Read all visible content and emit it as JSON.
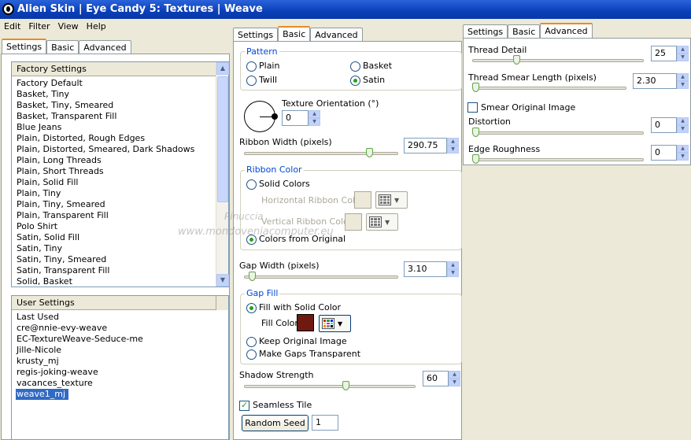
{
  "title": "Alien Skin  |  Eye Candy 5: Textures  |  Weave",
  "menu": [
    "Edit",
    "Filter",
    "View",
    "Help"
  ],
  "panel1": {
    "tabs": [
      "Settings",
      "Basic",
      "Advanced"
    ],
    "factory_header": "Factory Settings",
    "factory_items": [
      "Factory Default",
      "Basket, Tiny",
      "Basket, Tiny, Smeared",
      "Basket, Transparent Fill",
      "Blue Jeans",
      "Plain, Distorted, Rough Edges",
      "Plain, Distorted, Smeared, Dark Shadows",
      "Plain, Long Threads",
      "Plain, Short Threads",
      "Plain, Solid Fill",
      "Plain, Tiny",
      "Plain, Tiny, Smeared",
      "Plain, Transparent Fill",
      "Polo Shirt",
      "Satin, Solid Fill",
      "Satin, Tiny",
      "Satin, Tiny, Smeared",
      "Satin, Transparent Fill",
      "Solid, Basket"
    ],
    "user_header": "User Settings",
    "user_items": [
      "Last Used",
      "cre@nnie-evy-weave",
      "EC-TextureWeave-Seduce-me",
      "Jille-Nicole",
      "krusty_mj",
      "regis-joking-weave",
      "vacances_texture",
      "weave1_mj"
    ]
  },
  "panel2": {
    "tabs": [
      "Settings",
      "Basic",
      "Advanced"
    ],
    "pattern_label": "Pattern",
    "pattern": {
      "plain": "Plain",
      "basket": "Basket",
      "twill": "Twill",
      "satin": "Satin",
      "selected": "Satin"
    },
    "orientation_label": "Texture Orientation (°)",
    "orientation_value": "0",
    "ribbon_width_label": "Ribbon Width (pixels)",
    "ribbon_width_value": "290.75",
    "ribbon_width_level": 0.83,
    "ribbon_color_label": "Ribbon Color",
    "solid_colors": "Solid Colors",
    "horizontal_color": "Horizontal Ribbon Color",
    "vertical_color": "Vertical Ribbon Color",
    "from_original": "Colors from Original",
    "gap_width_label": "Gap Width (pixels)",
    "gap_width_value": "3.10",
    "gap_width_level": 0.03,
    "gap_fill_label": "Gap Fill",
    "fill_solid": "Fill with Solid Color",
    "fill_color_label": "Fill Color",
    "fill_color": "#6e1a10",
    "keep_original": "Keep Original Image",
    "make_transparent": "Make Gaps Transparent",
    "shadow_label": "Shadow Strength",
    "shadow_value": "60",
    "shadow_level": 0.6,
    "seamless_label": "Seamless Tile",
    "random_seed_button": "Random Seed",
    "random_seed_value": "1"
  },
  "panel3": {
    "tabs": [
      "Settings",
      "Basic",
      "Advanced"
    ],
    "thread_detail_label": "Thread Detail",
    "thread_detail_value": "25",
    "thread_detail_level": 0.25,
    "thread_smear_label": "Thread Smear Length (pixels)",
    "thread_smear_value": "2.30",
    "thread_smear_level": 0.0,
    "smear_original_label": "Smear Original Image",
    "distortion_label": "Distortion",
    "distortion_value": "0",
    "edge_label": "Edge Roughness",
    "edge_value": "0"
  },
  "watermark": {
    "line1": "Pinuccia",
    "line2": "www.mondoveniacomputer.eu"
  }
}
